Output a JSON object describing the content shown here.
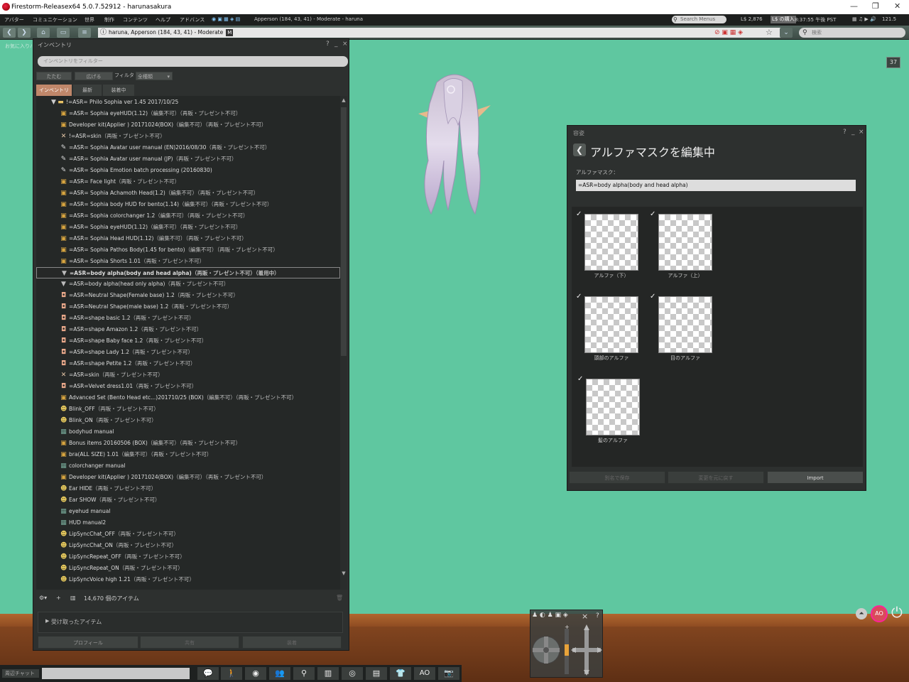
{
  "window": {
    "title": "Firestorm-Releasex64 5.0.7.52912 - harunasakura"
  },
  "menubar": {
    "items": [
      "アバター",
      "コミュニケーション",
      "世界",
      "制作",
      "コンテンツ",
      "ヘルプ",
      "アドバンス"
    ],
    "location": "Apperson (184, 43, 41) - Moderate - haruna",
    "search_placeholder": "Search Menus",
    "balance": "L$ 2,876",
    "buy_label": "L$ の購入",
    "time": "8:37:55 午後 PST",
    "fps": "121.5"
  },
  "navbar": {
    "location": "haruna, Apperson (184, 43, 41) - Moderate",
    "maturity": "M",
    "search_placeholder": "検索"
  },
  "favorites_label": "お気に入りバー",
  "scene_badge": "37",
  "inventory": {
    "title": "インベントリ",
    "help": "?",
    "minimize": "_",
    "close": "×",
    "filter_placeholder": "インベントリをフィルター",
    "collapse_label": "たたむ",
    "expand_label": "広げる",
    "filter_label": "フィルタ",
    "filter_value": "全種類",
    "tabs": [
      "インベントリ",
      "最新",
      "装着中"
    ],
    "folder": "!=ASR= Philo Sophia ver 1.45 2017/10/25",
    "items": [
      {
        "icon": "box",
        "name": "=ASR= Sophia eyeHUD(1.12)",
        "perm": "（編集不可）（再販・プレゼント不可）"
      },
      {
        "icon": "box",
        "name": "Developer kit(Applier ) 20171024(BOX)",
        "perm": "（編集不可）（再販・プレゼント不可）"
      },
      {
        "icon": "skin",
        "name": "!=ASR=skin",
        "perm": "（再販・プレゼント不可）"
      },
      {
        "icon": "note",
        "name": "=ASR=  Sophia Avatar user manual (EN)2016/08/30",
        "perm": "（再販・プレゼント不可）"
      },
      {
        "icon": "note",
        "name": "=ASR=  Sophia Avatar user manual (JP)",
        "perm": "（再販・プレゼント不可）"
      },
      {
        "icon": "note",
        "name": "=ASR=  Sophia Emotion batch processing (20160830)",
        "perm": ""
      },
      {
        "icon": "box",
        "name": "=ASR= Face light",
        "perm": "（再販・プレゼント不可）"
      },
      {
        "icon": "box",
        "name": "=ASR= Sophia Achamoth Head(1.2)",
        "perm": "（編集不可）（再販・プレゼント不可）"
      },
      {
        "icon": "box",
        "name": "=ASR= Sophia body HUD for bento(1.14)",
        "perm": "（編集不可）（再販・プレゼント不可）"
      },
      {
        "icon": "box",
        "name": "=ASR= Sophia colorchanger 1.2",
        "perm": "（編集不可）（再販・プレゼント不可）"
      },
      {
        "icon": "box",
        "name": "=ASR= Sophia eyeHUD(1.12)",
        "perm": "（編集不可）（再販・プレゼント不可）"
      },
      {
        "icon": "box",
        "name": "=ASR= Sophia Head HUD(1.12)",
        "perm": "（編集不可）（再販・プレゼント不可）"
      },
      {
        "icon": "box",
        "name": "=ASR= Sophia Pathos Body(1.45 for bento)",
        "perm": "（編集不可）（再販・プレゼント不可）"
      },
      {
        "icon": "box",
        "name": "=ASR= Sophia Shorts 1.01",
        "perm": "（再販・プレゼント不可）"
      },
      {
        "icon": "shirt",
        "name": "=ASR=body alpha(body and head alpha)",
        "perm": "（再販・プレゼント不可）（着用中）",
        "selected": true
      },
      {
        "icon": "shirt",
        "name": "=ASR=body alpha(head only alpha)",
        "perm": "（再販・プレゼント不可）"
      },
      {
        "icon": "shape",
        "name": "=ASR=Neutral Shape(Female base) 1.2",
        "perm": "（再販・プレゼント不可）"
      },
      {
        "icon": "shape",
        "name": "=ASR=Neutral Shape(male base) 1.2",
        "perm": "（再販・プレゼント不可）"
      },
      {
        "icon": "shape",
        "name": "=ASR=shape  basic 1.2",
        "perm": "（再販・プレゼント不可）"
      },
      {
        "icon": "shape",
        "name": "=ASR=shape Amazon 1.2",
        "perm": "（再販・プレゼント不可）"
      },
      {
        "icon": "shape",
        "name": "=ASR=shape Baby face 1.2",
        "perm": "（再販・プレゼント不可）"
      },
      {
        "icon": "shape",
        "name": "=ASR=shape Lady 1.2",
        "perm": "（再販・プレゼント不可）"
      },
      {
        "icon": "shape",
        "name": "=ASR=shape Petite 1.2",
        "perm": "（再販・プレゼント不可）"
      },
      {
        "icon": "skin",
        "name": "=ASR=skin",
        "perm": "（再販・プレゼント不可）"
      },
      {
        "icon": "shape",
        "name": "=ASR=Velvet dress1.01",
        "perm": "（再販・プレゼント不可）"
      },
      {
        "icon": "box",
        "name": "Advanced Set (Bento Head etc...)201710/25 (BOX)",
        "perm": "（編集不可）（再販・プレゼント不可）"
      },
      {
        "icon": "gesture",
        "name": "Blink_OFF",
        "perm": "（再販・プレゼント不可）"
      },
      {
        "icon": "gesture",
        "name": "Blink_ON",
        "perm": "（再販・プレゼント不可）"
      },
      {
        "icon": "texture",
        "name": "bodyhud manual",
        "perm": ""
      },
      {
        "icon": "box",
        "name": "Bonus items 20160506 (BOX)",
        "perm": "（編集不可）（再販・プレゼント不可）"
      },
      {
        "icon": "box",
        "name": "bra(ALL SIZE) 1.01",
        "perm": "（編集不可）（再販・プレゼント不可）"
      },
      {
        "icon": "texture",
        "name": "colorchanger  manual",
        "perm": ""
      },
      {
        "icon": "box",
        "name": "Developer kit(Applier ) 20171024(BOX)",
        "perm": "（編集不可）（再販・プレゼント不可）"
      },
      {
        "icon": "gesture",
        "name": "Ear HIDE",
        "perm": "（再販・プレゼント不可）"
      },
      {
        "icon": "gesture",
        "name": "Ear SHOW",
        "perm": "（再販・プレゼント不可）"
      },
      {
        "icon": "texture",
        "name": "eyehud manual",
        "perm": ""
      },
      {
        "icon": "texture",
        "name": "HUD manual2",
        "perm": ""
      },
      {
        "icon": "gesture",
        "name": "LipSyncChat_OFF",
        "perm": "（再販・プレゼント不可）"
      },
      {
        "icon": "gesture",
        "name": "LipSyncChat_ON",
        "perm": "（再販・プレゼント不可）"
      },
      {
        "icon": "gesture",
        "name": "LipSyncRepeat_OFF",
        "perm": "（再販・プレゼント不可）"
      },
      {
        "icon": "gesture",
        "name": "LipSyncRepeat_ON",
        "perm": "（再販・プレゼント不可）"
      },
      {
        "icon": "gesture",
        "name": "LipSyncVoice high 1.21",
        "perm": "（再販・プレゼント不可）"
      }
    ],
    "item_count": "14,670 個のアイテム",
    "received_label": "受け取ったアイテム",
    "buttons": [
      "プロフィール",
      "共有",
      "装着"
    ]
  },
  "appearance": {
    "header": "容姿",
    "title": "アルファマスクを編集中",
    "mask_label": "アルファマスク：",
    "mask_value": "=ASR=body alpha(body and head alpha)",
    "slots": [
      {
        "label": "アルファ（下）",
        "checked": true
      },
      {
        "label": "アルファ（上）",
        "checked": true
      },
      {
        "label": "頭部のアルファ",
        "checked": true
      },
      {
        "label": "目のアルファ",
        "checked": true
      },
      {
        "label": "髪のアルファ",
        "checked": true
      }
    ],
    "buttons": [
      "別名で保存",
      "変更を元に戻す",
      "Import"
    ],
    "check_mark": "✓"
  },
  "bottombar": {
    "chat_label": "周辺チャット",
    "ao_label": "AO"
  },
  "camera": {
    "help": "?",
    "close": "×"
  },
  "colors": {
    "accent_tab": "#c0876a",
    "background": "#5fc7a0",
    "panel": "#2d302f"
  }
}
